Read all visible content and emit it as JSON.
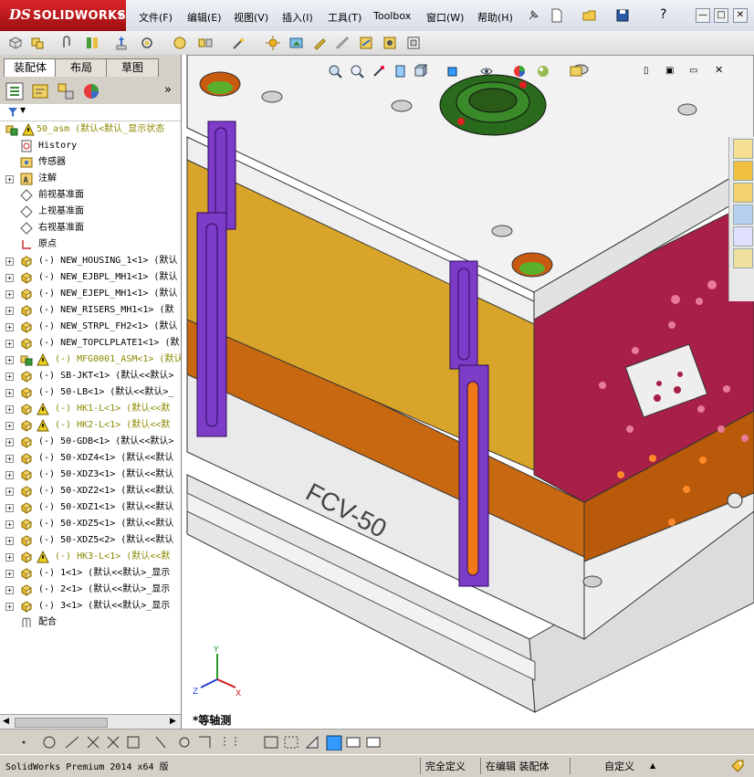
{
  "app": {
    "brand": "SOLIDWORKS",
    "logo_mark": "DS"
  },
  "menu": [
    {
      "label": "文件(F)"
    },
    {
      "label": "编辑(E)"
    },
    {
      "label": "视图(V)"
    },
    {
      "label": "插入(I)"
    },
    {
      "label": "工具(T)"
    },
    {
      "label": "Toolbox"
    },
    {
      "label": "窗口(W)"
    },
    {
      "label": "帮助(H)"
    }
  ],
  "window_controls": {
    "minimize": "—",
    "restore": "□",
    "close": "✕",
    "help": "?"
  },
  "panel": {
    "tabs": [
      {
        "label": "装配体"
      },
      {
        "label": "布局"
      },
      {
        "label": "草图"
      }
    ],
    "expand_glyph": "»",
    "filter_glyph": "▼"
  },
  "tree": {
    "root": {
      "label": "50_asm  (默认<默认_显示状态"
    },
    "items": [
      {
        "label": "History",
        "icon": "history-icon",
        "expand": false
      },
      {
        "label": "传感器",
        "icon": "sensor-icon",
        "expand": false
      },
      {
        "label": "注解",
        "icon": "annotation-icon",
        "expand": true
      },
      {
        "label": "前视基准面",
        "icon": "plane-icon",
        "expand": false
      },
      {
        "label": "上视基准面",
        "icon": "plane-icon",
        "expand": false
      },
      {
        "label": "右视基准面",
        "icon": "plane-icon",
        "expand": false
      },
      {
        "label": "原点",
        "icon": "origin-icon",
        "expand": false
      },
      {
        "label": "(-) NEW_HOUSING_1<1> (默认",
        "icon": "part-icon",
        "expand": true,
        "warn": false
      },
      {
        "label": "(-) NEW_EJBPL_MH1<1> (默认",
        "icon": "part-icon",
        "expand": true,
        "warn": false
      },
      {
        "label": "(-) NEW_EJEPL_MH1<1> (默认",
        "icon": "part-icon",
        "expand": true,
        "warn": false
      },
      {
        "label": "(-) NEW_RISERS_MH1<1> (默",
        "icon": "part-icon",
        "expand": true,
        "warn": false
      },
      {
        "label": "(-) NEW_STRPL_FH2<1> (默认",
        "icon": "part-icon",
        "expand": true,
        "warn": false
      },
      {
        "label": "(-) NEW_TOPCLPLATE1<1> (默",
        "icon": "part-icon",
        "expand": true,
        "warn": false
      },
      {
        "label": "(-) MFG0001_ASM<1> (默认",
        "icon": "assembly-icon",
        "expand": true,
        "warn": true
      },
      {
        "label": "(-) SB-JKT<1> (默认<<默认>",
        "icon": "part-icon",
        "expand": true,
        "warn": false
      },
      {
        "label": "(-) 50-LB<1> (默认<<默认>_",
        "icon": "part-icon",
        "expand": true,
        "warn": false
      },
      {
        "label": "(-) HK1-L<1> (默认<<默",
        "icon": "part-icon",
        "expand": true,
        "warn": true
      },
      {
        "label": "(-) HK2-L<1> (默认<<默",
        "icon": "part-icon",
        "expand": true,
        "warn": true
      },
      {
        "label": "(-) 50-GDB<1> (默认<<默认>",
        "icon": "part-icon",
        "expand": true,
        "warn": false
      },
      {
        "label": "(-) 50-XDZ4<1> (默认<<默认",
        "icon": "part-icon",
        "expand": true,
        "warn": false
      },
      {
        "label": "(-) 50-XDZ3<1> (默认<<默认",
        "icon": "part-icon",
        "expand": true,
        "warn": false
      },
      {
        "label": "(-) 50-XDZ2<1> (默认<<默认",
        "icon": "part-icon",
        "expand": true,
        "warn": false
      },
      {
        "label": "(-) 50-XDZ1<1> (默认<<默认",
        "icon": "part-icon",
        "expand": true,
        "warn": false
      },
      {
        "label": "(-) 50-XDZ5<1> (默认<<默认",
        "icon": "part-icon",
        "expand": true,
        "warn": false
      },
      {
        "label": "(-) 50-XDZ5<2> (默认<<默认",
        "icon": "part-icon",
        "expand": true,
        "warn": false
      },
      {
        "label": "(-) HK3-L<1> (默认<<默",
        "icon": "part-icon",
        "expand": true,
        "warn": true
      },
      {
        "label": "(-) 1<1> (默认<<默认>_显示",
        "icon": "part-icon",
        "expand": true,
        "warn": false
      },
      {
        "label": "(-) 2<1> (默认<<默认>_显示",
        "icon": "part-icon",
        "expand": true,
        "warn": false
      },
      {
        "label": "(-) 3<1> (默认<<默认>_显示",
        "icon": "part-icon",
        "expand": true,
        "warn": false
      },
      {
        "label": "配合",
        "icon": "mates-icon",
        "expand": false
      }
    ]
  },
  "viewport": {
    "view_name": "*等轴测",
    "mold_engraving": "FCV-50",
    "triad": {
      "x": "X",
      "y": "Y",
      "z": "Z"
    }
  },
  "status": {
    "product": "SolidWorks Premium 2014 x64 版",
    "fully_defined": "完全定义",
    "editing": "在编辑 装配体",
    "units": "自定义",
    "units_arrow": "▲"
  },
  "colors": {
    "warn": "#8a8a00",
    "yellow_plate": "#d8a82a",
    "orange_plate": "#cc6a10",
    "magenta_plate": "#a8204a",
    "grey_plate": "#ececec",
    "purple_arm": "#7d3cc8",
    "green_bush": "#2a6a1c",
    "logo_red": "#c81e24"
  }
}
